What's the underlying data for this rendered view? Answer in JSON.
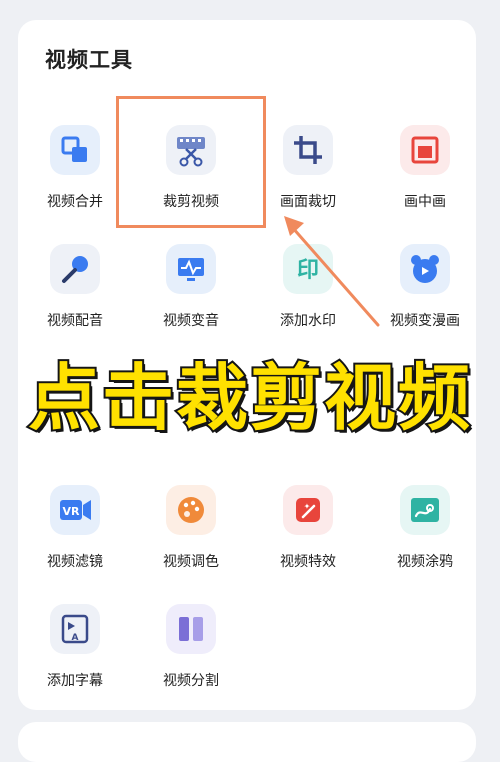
{
  "section_title": "视频工具",
  "banner_text": "点击裁剪视频",
  "tools": [
    {
      "label": "视频合并",
      "icon": "merge-icon"
    },
    {
      "label": "裁剪视频",
      "icon": "cut-video-icon"
    },
    {
      "label": "画面裁切",
      "icon": "crop-icon"
    },
    {
      "label": "画中画",
      "icon": "picture-in-picture-icon"
    },
    {
      "label": "视频配音",
      "icon": "microphone-icon"
    },
    {
      "label": "视频变音",
      "icon": "voice-change-icon"
    },
    {
      "label": "添加水印",
      "icon": "watermark-icon"
    },
    {
      "label": "视频变漫画",
      "icon": "bear-icon"
    },
    {
      "label": "视频滤镜",
      "icon": "vr-filter-icon"
    },
    {
      "label": "视频调色",
      "icon": "palette-icon"
    },
    {
      "label": "视频特效",
      "icon": "magic-wand-icon"
    },
    {
      "label": "视频涂鸦",
      "icon": "doodle-icon"
    },
    {
      "label": "添加字幕",
      "icon": "subtitle-icon"
    },
    {
      "label": "视频分割",
      "icon": "split-icon"
    }
  ],
  "colors": {
    "accent_blue": "#3a7bf0",
    "highlight_orange": "#f08a5d",
    "banner_yellow": "#ffe100",
    "red": "#e8453c"
  }
}
